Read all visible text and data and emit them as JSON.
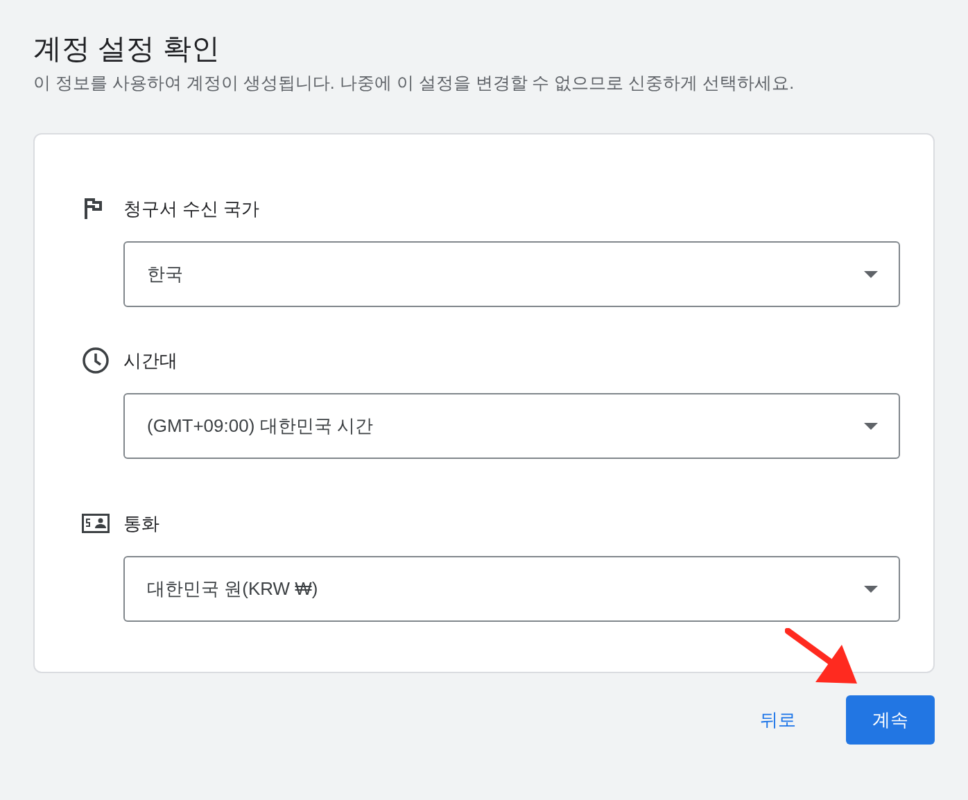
{
  "title": "계정 설정 확인",
  "subtitle": "이 정보를 사용하여 계정이 생성됩니다. 나중에 이 설정을 변경할 수 없으므로 신중하게 선택하세요.",
  "fields": [
    {
      "kind": "flag",
      "label": "청구서 수신 국가",
      "value": "한국"
    },
    {
      "kind": "clock",
      "label": "시간대",
      "value": "(GMT+09:00) 대한민국 시간"
    },
    {
      "kind": "currency",
      "label": "통화",
      "value": "대한민국 원(KRW ₩)"
    }
  ],
  "buttons": [
    {
      "kind": "text",
      "label": "뒤로"
    },
    {
      "kind": "primary",
      "label": "계속"
    }
  ]
}
